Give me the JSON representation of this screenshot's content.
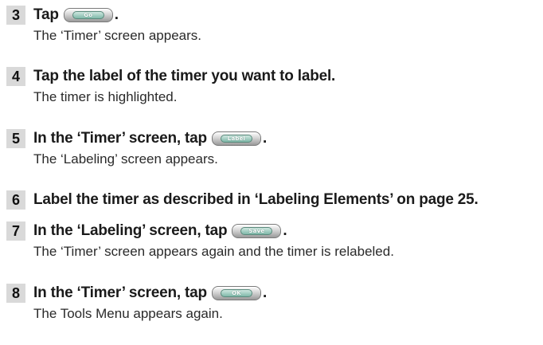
{
  "steps": [
    {
      "number": "3",
      "instruction_before": "Tap",
      "button": {
        "label": "Go",
        "icon": "go-button-icon"
      },
      "instruction_after": ".",
      "result": "The ‘Timer’ screen appears."
    },
    {
      "number": "4",
      "instruction": "Tap the label of the timer you want to label.",
      "result": "The timer is highlighted."
    },
    {
      "number": "5",
      "instruction_before": "In the ‘Timer’ screen, tap",
      "button": {
        "label": "Label",
        "icon": "label-button-icon"
      },
      "instruction_after": ".",
      "result": "The ‘Labeling’ screen appears."
    },
    {
      "number": "6",
      "instruction": "Label the timer as described in ‘Labeling Elements’ on page 25."
    },
    {
      "number": "7",
      "instruction_before": "In the ‘Labeling’ screen, tap",
      "button": {
        "label": "Save",
        "icon": "save-button-icon"
      },
      "instruction_after": ".",
      "result": "The ‘Timer’ screen appears again and the timer is relabeled."
    },
    {
      "number": "8",
      "instruction_before": "In the ‘Timer’ screen, tap",
      "button": {
        "label": "OK",
        "icon": "ok-button-icon"
      },
      "instruction_after": ".",
      "result": "The Tools Menu appears again."
    }
  ]
}
